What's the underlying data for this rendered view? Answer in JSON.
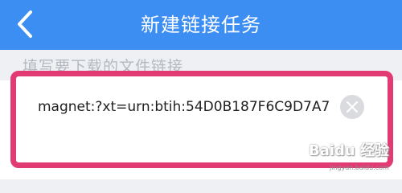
{
  "header": {
    "title": "新建链接任务",
    "back_icon": "chevron-left-icon"
  },
  "form": {
    "hint": "填写要下载的文件链接",
    "link_value": "magnet:?xt=urn:btih:54D0B187F6C9D7A7",
    "clear_icon": "close-icon"
  },
  "watermark": {
    "text": "Baidu 经验",
    "sub": "jingyan.baidu.com"
  },
  "colors": {
    "header_bg": "#3d8ef2",
    "highlight_border": "#e23b74"
  }
}
